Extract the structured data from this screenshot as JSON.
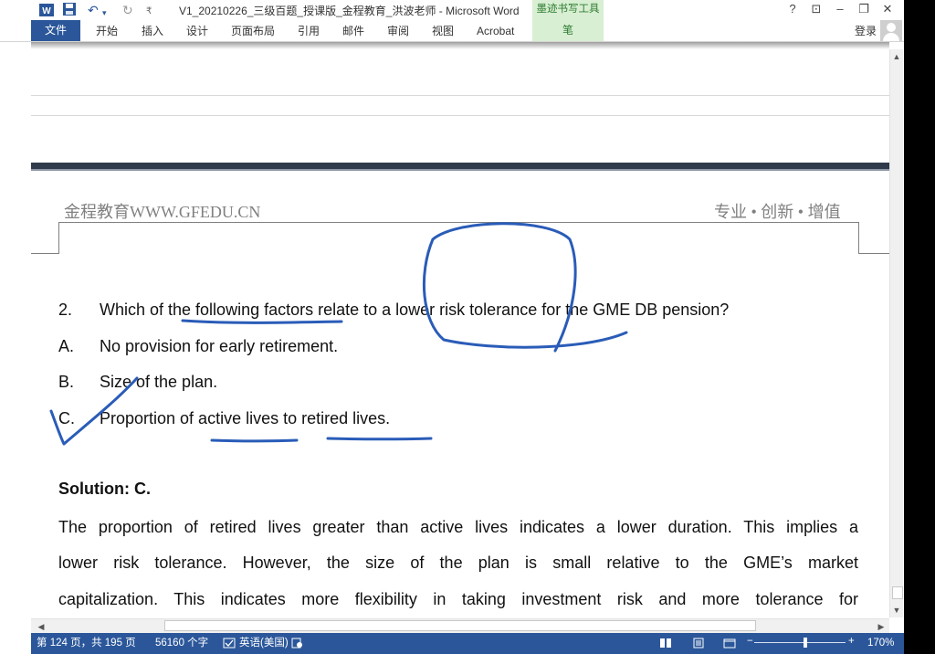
{
  "titlebar": {
    "doc_title": "V1_20210226_三级百题_授课版_金程教育_洪波老师 - Microsoft Word",
    "context_tab_title": "墨迹书写工具",
    "help": "?",
    "restore_ribbon": "⊡",
    "minimize": "–",
    "maximize": "❐",
    "close": "✕"
  },
  "ribbon": {
    "tabs": [
      {
        "label": "文件"
      },
      {
        "label": "开始"
      },
      {
        "label": "插入"
      },
      {
        "label": "设计"
      },
      {
        "label": "页面布局"
      },
      {
        "label": "引用"
      },
      {
        "label": "邮件"
      },
      {
        "label": "审阅"
      },
      {
        "label": "视图"
      },
      {
        "label": "Acrobat"
      },
      {
        "label": "笔"
      }
    ],
    "signin": "登录"
  },
  "document": {
    "header_left": "金程教育WWW.GFEDU.CN",
    "header_right": "专业 • 创新 • 增值",
    "question_number": "2.",
    "question_text": "Which of the following factors relate to a lower risk tolerance for the GME DB pension?",
    "options": [
      {
        "letter": "A.",
        "text": "No provision for early retirement."
      },
      {
        "letter": "B.",
        "text": "Size of the plan."
      },
      {
        "letter": "C.",
        "text": "Proportion of active lives to retired lives."
      }
    ],
    "solution_title": "Solution: C.",
    "solution_lines": [
      "The proportion of retired lives greater than active lives indicates a lower duration. This implies a",
      "lower risk tolerance. However, the size of the plan is small relative to the GME’s market",
      "capitalization. This indicates more flexibility in taking investment risk and more tolerance for"
    ],
    "ink_color": "#2a5cb8"
  },
  "statusbar": {
    "page": "第 124 页，共 195 页",
    "words": "56160 个字",
    "language": "英语(美国)",
    "zoom": "170%",
    "zoom_level": 0.56
  },
  "colors": {
    "brand": "#2b579a",
    "ink_tools": "#d8efd3"
  }
}
